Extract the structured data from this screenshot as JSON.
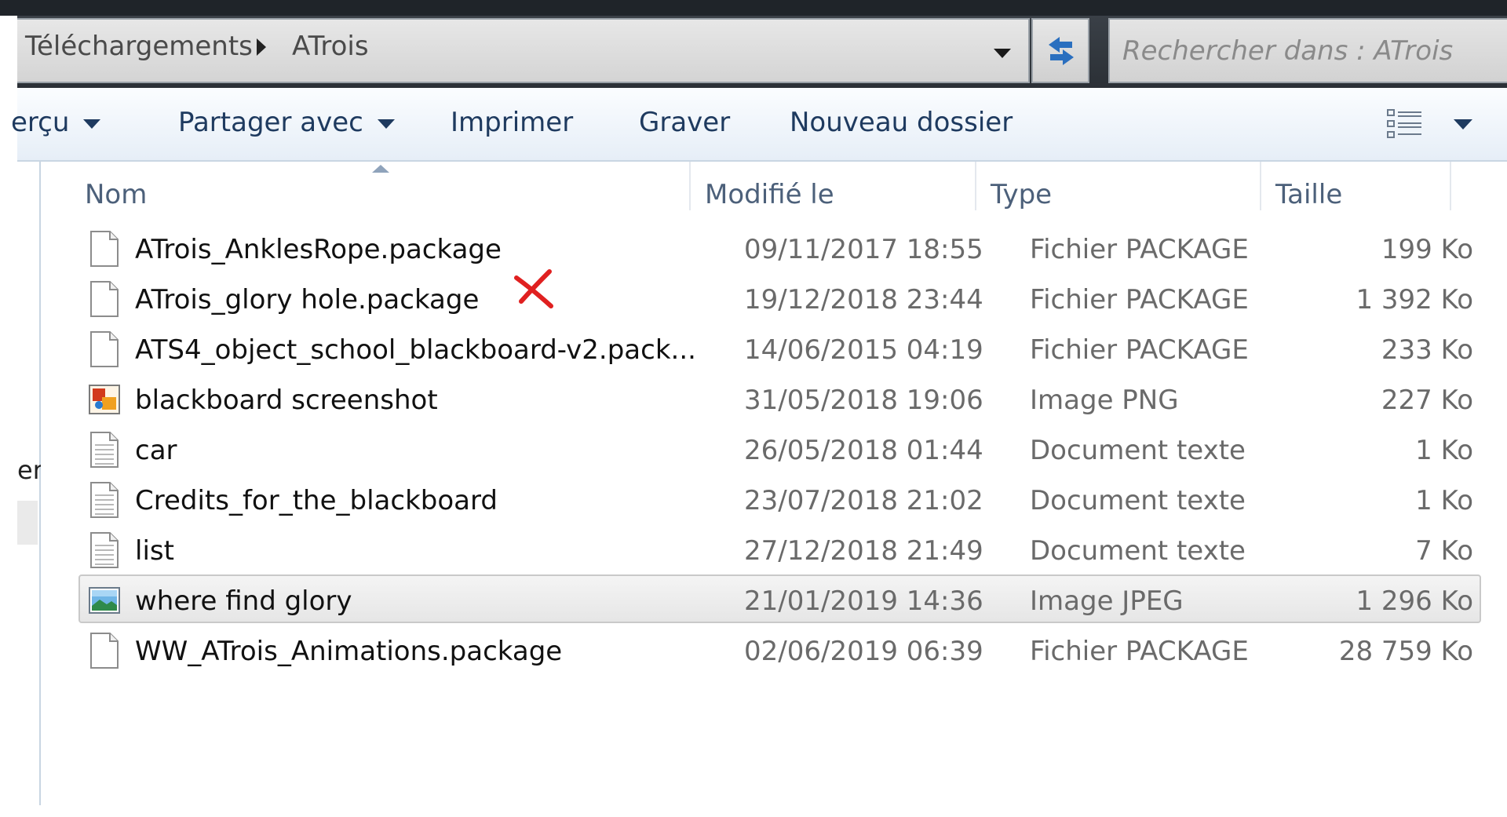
{
  "address": {
    "crumbs": [
      "Téléchargements",
      "ATrois"
    ],
    "search_placeholder": "Rechercher dans : ATrois"
  },
  "toolbar": {
    "apercu": "erçu",
    "partager": "Partager avec",
    "imprimer": "Imprimer",
    "graver": "Graver",
    "nouveau_dossier": "Nouveau dossier"
  },
  "nav": {
    "partial_text": "er"
  },
  "columns": {
    "name": "Nom",
    "modified": "Modifié le",
    "type": "Type",
    "size": "Taille"
  },
  "files": [
    {
      "name": "ATrois_AnklesRope.package",
      "modified": "09/11/2017 18:55",
      "type": "Fichier PACKAGE",
      "size": "199 Ko",
      "icon": "blank-file-icon"
    },
    {
      "name": "ATrois_glory hole.package",
      "modified": "19/12/2018 23:44",
      "type": "Fichier PACKAGE",
      "size": "1 392 Ko",
      "icon": "blank-file-icon",
      "marked": true
    },
    {
      "name": "ATS4_object_school_blackboard-v2.pack...",
      "modified": "14/06/2015 04:19",
      "type": "Fichier PACKAGE",
      "size": "233 Ko",
      "icon": "blank-file-icon"
    },
    {
      "name": "blackboard screenshot",
      "modified": "31/05/2018 19:06",
      "type": "Image PNG",
      "size": "227 Ko",
      "icon": "png-image-icon"
    },
    {
      "name": "car",
      "modified": "26/05/2018 01:44",
      "type": "Document texte",
      "size": "1 Ko",
      "icon": "text-document-icon"
    },
    {
      "name": "Credits_for_the_blackboard",
      "modified": "23/07/2018 21:02",
      "type": "Document texte",
      "size": "1 Ko",
      "icon": "text-document-icon"
    },
    {
      "name": "list",
      "modified": "27/12/2018 21:49",
      "type": "Document texte",
      "size": "7 Ko",
      "icon": "text-document-icon"
    },
    {
      "name": "where find glory",
      "modified": "21/01/2019 14:36",
      "type": "Image JPEG",
      "size": "1 296 Ko",
      "icon": "jpeg-image-icon",
      "hovered": true
    },
    {
      "name": "WW_ATrois_Animations.package",
      "modified": "02/06/2019 06:39",
      "type": "Fichier PACKAGE",
      "size": "28 759 Ko",
      "icon": "blank-file-icon"
    }
  ],
  "colors": {
    "toolbar_text": "#1e3a5f",
    "header_text": "#4c607a",
    "mark": "#e02020"
  }
}
